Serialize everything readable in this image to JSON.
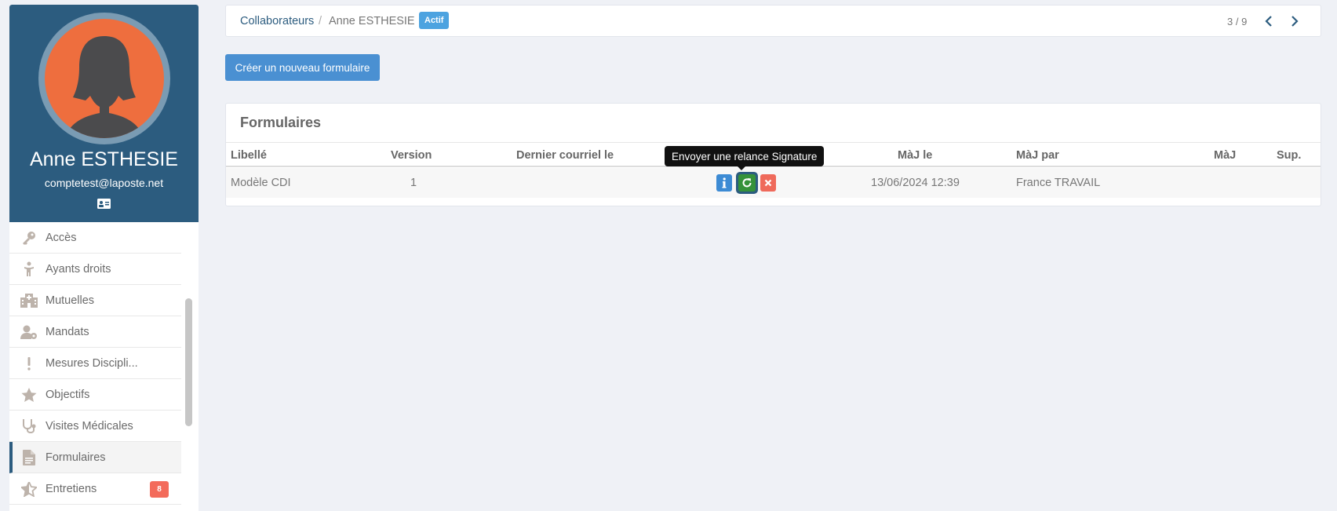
{
  "profile": {
    "name": "Anne ESTHESIE",
    "email": "comptetest@laposte.net"
  },
  "sidebar": {
    "items": [
      {
        "label": "Accès",
        "icon": "key-icon"
      },
      {
        "label": "Ayants droits",
        "icon": "child-icon"
      },
      {
        "label": "Mutuelles",
        "icon": "hospital-icon"
      },
      {
        "label": "Mandats",
        "icon": "user-gear-icon"
      },
      {
        "label": "Mesures Discipli...",
        "icon": "exclamation-icon"
      },
      {
        "label": "Objectifs",
        "icon": "star-icon"
      },
      {
        "label": "Visites Médicales",
        "icon": "stethoscope-icon"
      },
      {
        "label": "Formulaires",
        "icon": "file-icon",
        "active": true
      },
      {
        "label": "Entretiens",
        "icon": "star-half-icon",
        "badge": "8"
      }
    ]
  },
  "breadcrumb": {
    "parent": "Collaborateurs",
    "separator": "/",
    "current": "Anne ESTHESIE",
    "status": "Actif"
  },
  "pager": {
    "text": "3 / 9"
  },
  "actions": {
    "create_label": "Créer un nouveau formulaire"
  },
  "forms": {
    "title": "Formulaires",
    "headers": {
      "libelle": "Libellé",
      "version": "Version",
      "dernier_courriel": "Dernier courriel le",
      "maj_le": "MàJ le",
      "maj_par": "MàJ par",
      "maj": "MàJ",
      "sup": "Sup."
    },
    "rows": [
      {
        "libelle": "Modèle CDI",
        "version": "1",
        "dernier_courriel": "",
        "maj_le": "13/06/2024 12:39",
        "maj_par": "France TRAVAIL"
      }
    ]
  },
  "tooltip": {
    "text": "Envoyer une relance Signature"
  },
  "colors": {
    "primary": "#2c5c7f",
    "button_blue": "#4a90d2",
    "success": "#35923a",
    "danger": "#ef6a5b",
    "avatar_bg": "#ee6e3e"
  }
}
